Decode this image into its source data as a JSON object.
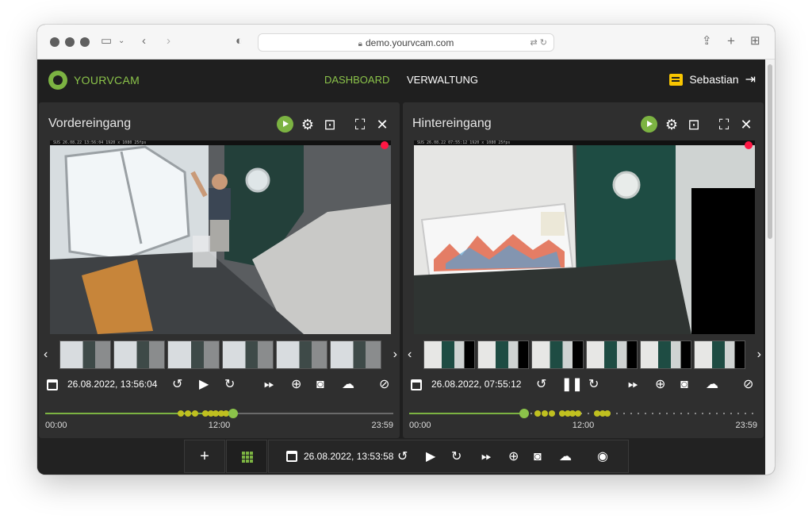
{
  "browser": {
    "url": "demo.yourvcam.com"
  },
  "app": {
    "brand": "YOURVCAM",
    "nav": [
      {
        "label": "DASHBOARD",
        "active": true
      },
      {
        "label": "VERWALTUNG",
        "active": false
      }
    ],
    "user_name": "Sebastian"
  },
  "colors": {
    "accent": "#8bc34a",
    "background": "#1f1f1f",
    "panel": "#2f2f2f",
    "record": "#ff1744",
    "event": "#c0c020",
    "notice": "#f9c600"
  },
  "cameras": [
    {
      "title": "Vordereingang",
      "datetime": "26.08.2022, 13:56:04",
      "play_state": "paused",
      "progress": 0.54,
      "timeline_labels": {
        "start": "00:00",
        "mid": "12:00",
        "end": "23:59"
      },
      "events": [
        0.39,
        0.41,
        0.43,
        0.46,
        0.475,
        0.49,
        0.505,
        0.52,
        0.535
      ]
    },
    {
      "title": "Hintereingang",
      "datetime": "26.08.2022, 07:55:12",
      "play_state": "playing",
      "progress": 0.33,
      "timeline_labels": {
        "start": "00:00",
        "mid": "12:00",
        "end": "23:59"
      },
      "events": [
        0.37,
        0.39,
        0.41,
        0.44,
        0.455,
        0.47,
        0.485,
        0.54,
        0.555,
        0.57
      ]
    }
  ],
  "global_controls": {
    "datetime": "26.08.2022, 13:53:58"
  },
  "icons": [
    "calendar-icon",
    "replay-icon",
    "play-icon",
    "pause-icon",
    "redo-icon",
    "fast-forward-icon",
    "zoom-in-icon",
    "camera-icon",
    "cloud-download-icon",
    "visibility-off-icon",
    "visibility-icon",
    "settings-icon",
    "focus-icon",
    "fullscreen-icon",
    "close-icon"
  ]
}
